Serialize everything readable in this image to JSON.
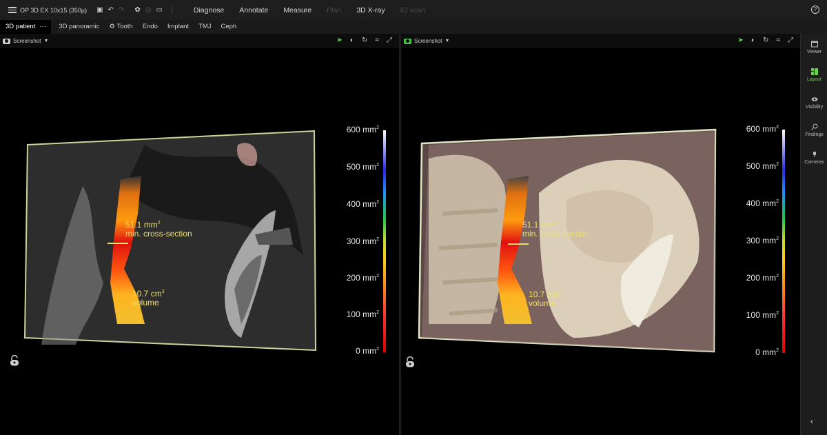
{
  "app": {
    "title": "OP 3D EX 10x15 (350µ)"
  },
  "top_nav": {
    "items": [
      {
        "label": "Diagnose",
        "enabled": true
      },
      {
        "label": "Annotate",
        "enabled": true
      },
      {
        "label": "Measure",
        "enabled": true
      },
      {
        "label": "Plan",
        "enabled": false
      },
      {
        "label": "3D X-ray",
        "enabled": true
      },
      {
        "label": "IO scan",
        "enabled": false
      }
    ]
  },
  "tabs": {
    "active": "3D patient",
    "items": [
      "3D panoramic",
      "Tooth",
      "Endo",
      "Implant",
      "TMJ",
      "Ceph"
    ]
  },
  "viewports": {
    "left": {
      "screenshot_label": "Screenshot",
      "min_cross_section_value": "51.1 mm",
      "min_cross_section_label": "min. cross-section",
      "volume_value": "10.7 cm",
      "volume_label": "volume",
      "scale": [
        "600 mm",
        "500 mm",
        "400 mm",
        "300 mm",
        "200 mm",
        "100 mm",
        "0 mm"
      ]
    },
    "right": {
      "screenshot_label": "Screenshot",
      "min_cross_section_value": "51.1 mm",
      "min_cross_section_label": "min. cross-section",
      "volume_value": "10.7 cm",
      "volume_label": "volume",
      "scale": [
        "600 mm",
        "500 mm",
        "400 mm",
        "300 mm",
        "200 mm",
        "100 mm",
        "0 mm"
      ]
    }
  },
  "sidebar": {
    "items": [
      {
        "label": "Viewer",
        "icon": "viewer-icon",
        "active": false
      },
      {
        "label": "Layout",
        "icon": "layout-icon",
        "active": true
      },
      {
        "label": "Visibility",
        "icon": "eye-icon",
        "active": false
      },
      {
        "label": "Findings",
        "icon": "findings-icon",
        "active": false
      },
      {
        "label": "Cameras",
        "icon": "camera-icon",
        "active": false
      }
    ]
  },
  "colors": {
    "accent": "#6ccf4f",
    "annotation": "#f0e06a"
  }
}
